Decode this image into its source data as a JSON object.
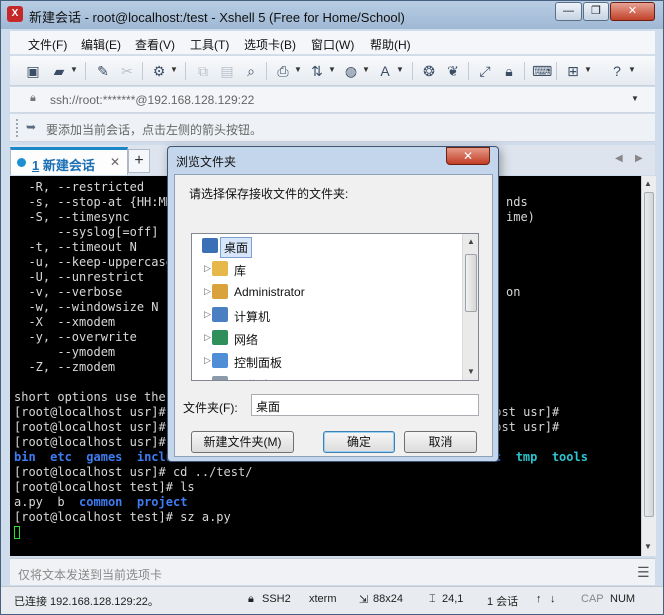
{
  "window": {
    "title": "新建会话 - root@localhost:/test - Xshell 5 (Free for Home/School)",
    "controls": {
      "minimize": "—",
      "maximize": "❐",
      "close": "✕"
    }
  },
  "menu": {
    "items": [
      "文件(F)",
      "编辑(E)",
      "查看(V)",
      "工具(T)",
      "选项卡(B)",
      "窗口(W)",
      "帮助(H)"
    ]
  },
  "toolbar": {
    "icons": [
      "new-session-icon",
      "open-folder-icon",
      "connect-icon",
      "disconnect-icon",
      "properties-icon",
      "copy-icon",
      "paste-icon",
      "find-icon",
      "print-icon",
      "transfer-icon",
      "globe-icon",
      "font-icon",
      "xftp-icon",
      "script-icon",
      "fullscreen-icon",
      "lock-icon",
      "keyboard-icon",
      "add-icon",
      "help-icon"
    ]
  },
  "address": {
    "value": "ssh://root:*******@192.168.128.129:22"
  },
  "hint": {
    "text": "要添加当前会话，点击左侧的箭头按钮。"
  },
  "tabs": {
    "active_number": "1",
    "active_label": "新建会话",
    "new_tab": "+"
  },
  "terminal": {
    "lines": [
      "  -R, --restricted",
      "  -s, --stop-at {HH:MM",
      "  -S, --timesync",
      "      --syslog[=off]",
      "  -t, --timeout N",
      "  -u, --keep-uppercase",
      "  -U, --unrestrict",
      "  -v, --verbose",
      "  -w, --windowsize N",
      "  -X  --xmodem",
      "  -y, --overwrite",
      "      --ymodem",
      "  -Z, --zmodem",
      "",
      "short options use the",
      "[root@localhost usr]#",
      "[root@localhost usr]#",
      "[root@localhost usr]#"
    ],
    "right_fragments": {
      "line2": "nds",
      "line3": "ime)",
      "line8": "on",
      "line16": "host usr]#",
      "line17": "host usr]#"
    },
    "listing_usr": [
      "bin",
      "etc",
      "games",
      "inclu"
    ],
    "listing_usr_right": [
      "c",
      "tmp",
      "tools"
    ],
    "cmd_cd": "[root@localhost usr]# cd ../test/",
    "cmd_ls": "[root@localhost test]# ls",
    "listing_test": [
      "a.py",
      "b",
      "common",
      "project"
    ],
    "cmd_sz": "[root@localhost test]# sz a.py"
  },
  "sendbar": {
    "text": "仅将文本发送到当前选项卡"
  },
  "status": {
    "connection": "已连接 192.168.128.129:22。",
    "protocol": "SSH2",
    "terminal_type": "xterm",
    "size": "88x24",
    "position": "24,1",
    "sessions": "1 会话",
    "cap": "CAP",
    "num": "NUM"
  },
  "dialog": {
    "title": "浏览文件夹",
    "prompt": "请选择保存接收文件的文件夹:",
    "tree": [
      {
        "label": "桌面",
        "icon": "desktop-icon",
        "color": "#3b6fb6",
        "selected": true,
        "expandable": false
      },
      {
        "label": "库",
        "icon": "library-icon",
        "color": "#e6b84a",
        "selected": false,
        "expandable": true
      },
      {
        "label": "Administrator",
        "icon": "user-folder-icon",
        "color": "#d9a23b",
        "selected": false,
        "expandable": true
      },
      {
        "label": "计算机",
        "icon": "computer-icon",
        "color": "#4a7fc1",
        "selected": false,
        "expandable": true
      },
      {
        "label": "网络",
        "icon": "network-icon",
        "color": "#2f8f5a",
        "selected": false,
        "expandable": true
      },
      {
        "label": "控制面板",
        "icon": "control-panel-icon",
        "color": "#4f8ed6",
        "selected": false,
        "expandable": true
      },
      {
        "label": "回收站",
        "icon": "recycle-bin-icon",
        "color": "#8a9aa8",
        "selected": false,
        "expandable": false
      }
    ],
    "folder_label": "文件夹(F):",
    "folder_value": "桌面",
    "new_folder_button": "新建文件夹(M)",
    "ok_button": "确定",
    "cancel_button": "取消"
  },
  "colors": {
    "accent": "#1a87c9",
    "terminal_bg": "#000000",
    "dir_blue": "#3e7cf2",
    "dir_cyan": "#2cc4cf",
    "cursor": "#2be02b"
  }
}
